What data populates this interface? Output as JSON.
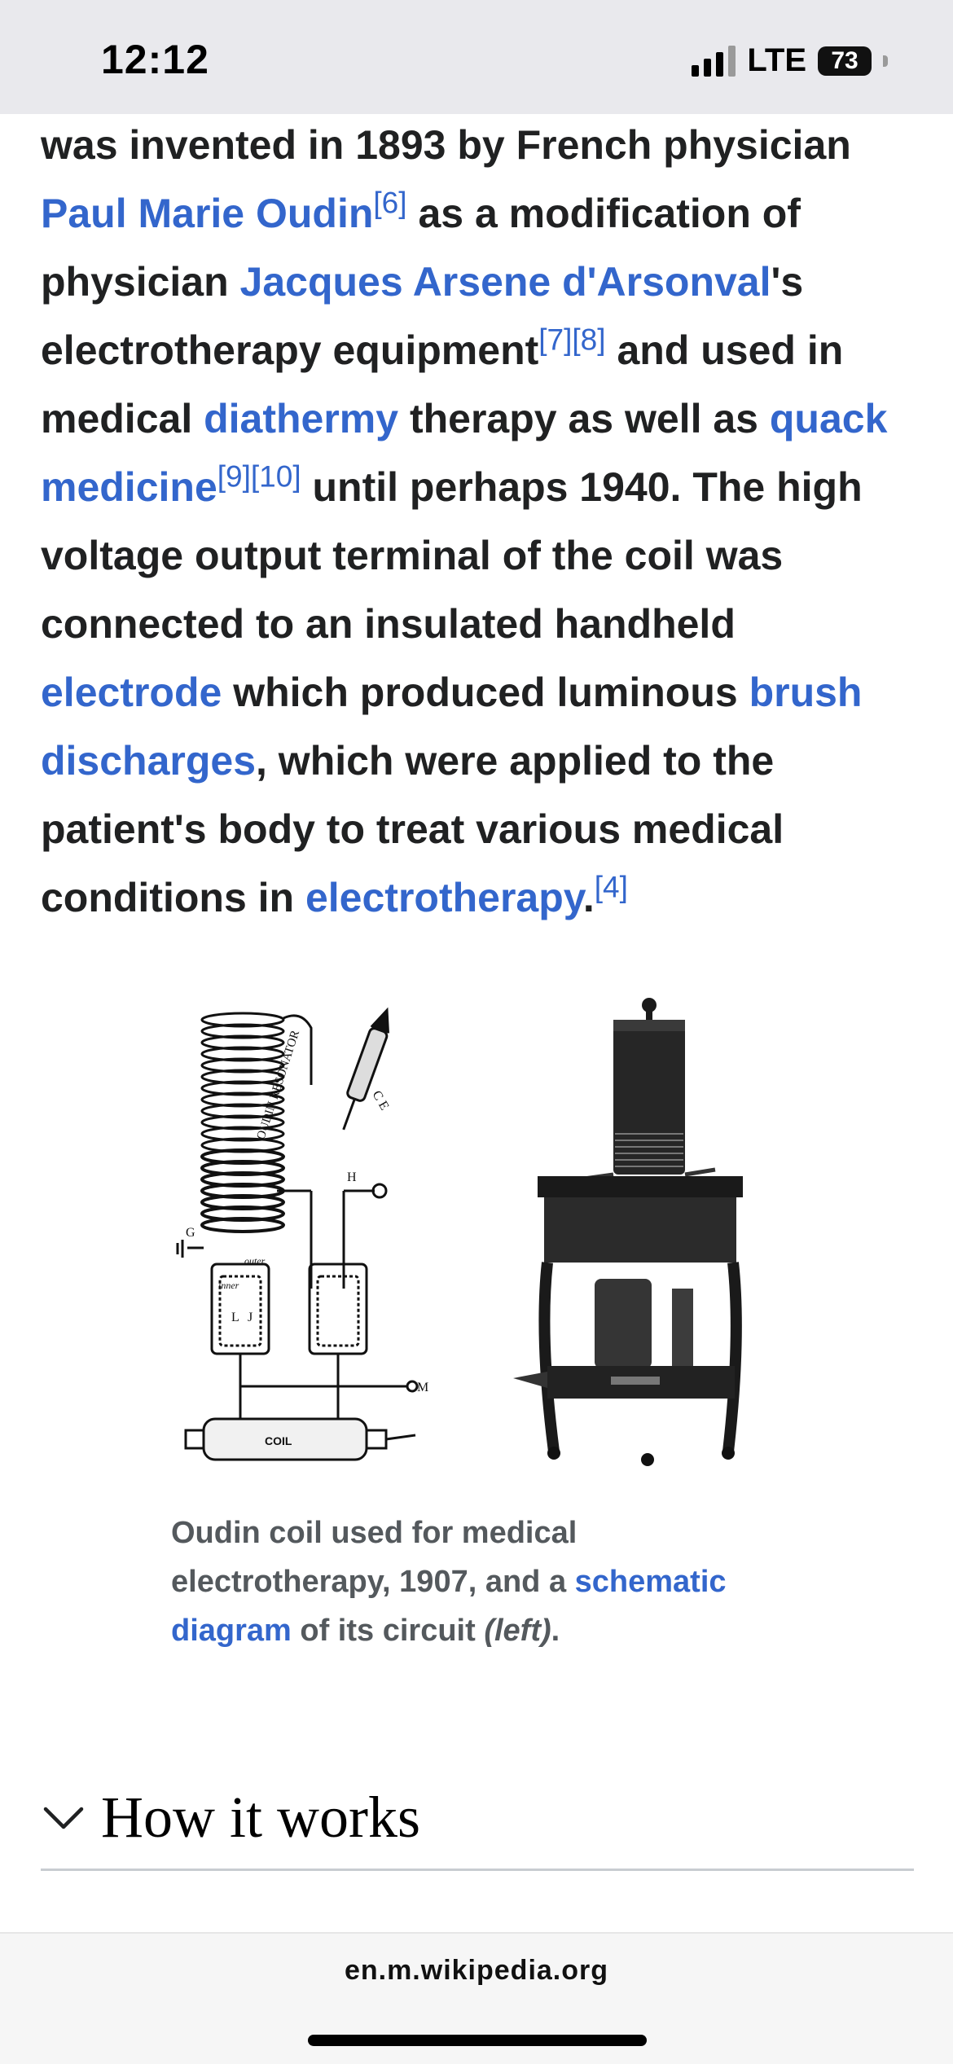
{
  "status_bar": {
    "time": "12:12",
    "network": "LTE",
    "battery": "73"
  },
  "article": {
    "segments": {
      "s1": "was invented in 1893 by French physician ",
      "l_oudin": "Paul Marie Oudin",
      "r6": "[6]",
      "s2": " as a modification of physician ",
      "l_darsonval": "Jacques Arsene d'Arsonval",
      "s3": "'s electrotherapy equipment",
      "r7": "[7]",
      "r8": "[8]",
      "s4": " and used in medical ",
      "l_diathermy": "diathermy",
      "s5": " therapy as well as ",
      "l_quack": "quack medicine",
      "r9": "[9]",
      "r10": "[10]",
      "s6": " until perhaps 1940. The high voltage output terminal of the coil was connected to an insulated handheld ",
      "l_electrode": "electrode",
      "s7": " which produced luminous ",
      "l_brush": "brush discharges",
      "s8": ", which were applied to the patient's body to treat various medical conditions in ",
      "l_electrotherapy": "electrotherapy",
      "s9": ".",
      "r4": "[4]"
    }
  },
  "figure": {
    "image_text": {
      "resonator": "OUDIN RESONATOR",
      "ce": "C E",
      "h": "H",
      "g": "G",
      "outer": "outer",
      "inner": "inner",
      "l": "L",
      "j": "J",
      "m": "M",
      "coil": "COIL"
    },
    "caption": {
      "part1": "Oudin coil used for medical electrotherapy, 1907, and a ",
      "link": "schematic diagram",
      "part2": " of its circuit ",
      "italic": "(left)",
      "part3": "."
    }
  },
  "section": {
    "title": "How it works"
  },
  "browser": {
    "url": "en.m.wikipedia.org"
  }
}
